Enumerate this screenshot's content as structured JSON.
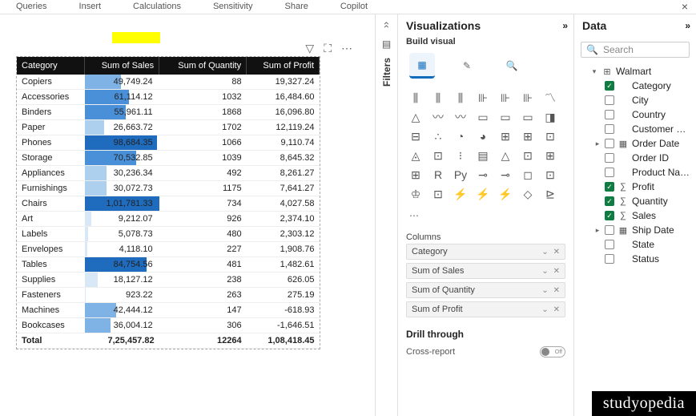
{
  "menu": {
    "queries": "Queries",
    "insert": "Insert",
    "calculations": "Calculations",
    "sensitivity": "Sensitivity",
    "share": "Share",
    "copilot": "Copilot",
    "close": "×"
  },
  "matrix": {
    "headers": {
      "category": "Category",
      "sales": "Sum of Sales",
      "quantity": "Sum of Quantity",
      "profit": "Sum of Profit"
    },
    "rows": [
      {
        "c": "Copiers",
        "s": "49,749.24",
        "sp": 49,
        "q": "88",
        "p": "19,327.24"
      },
      {
        "c": "Accessories",
        "s": "61,114.12",
        "sp": 60,
        "q": "1032",
        "p": "16,484.60"
      },
      {
        "c": "Binders",
        "s": "55,961.11",
        "sp": 55,
        "q": "1868",
        "p": "16,096.80"
      },
      {
        "c": "Paper",
        "s": "26,663.72",
        "sp": 26,
        "q": "1702",
        "p": "12,119.24"
      },
      {
        "c": "Phones",
        "s": "98,684.35",
        "sp": 97,
        "q": "1066",
        "p": "9,110.74"
      },
      {
        "c": "Storage",
        "s": "70,532.85",
        "sp": 69,
        "q": "1039",
        "p": "8,645.32"
      },
      {
        "c": "Appliances",
        "s": "30,236.34",
        "sp": 30,
        "q": "492",
        "p": "8,261.27"
      },
      {
        "c": "Furnishings",
        "s": "30,072.73",
        "sp": 30,
        "q": "1175",
        "p": "7,641.27"
      },
      {
        "c": "Chairs",
        "s": "1,01,781.33",
        "sp": 100,
        "q": "734",
        "p": "4,027.58"
      },
      {
        "c": "Art",
        "s": "9,212.07",
        "sp": 9,
        "q": "926",
        "p": "2,374.10"
      },
      {
        "c": "Labels",
        "s": "5,078.73",
        "sp": 5,
        "q": "480",
        "p": "2,303.12"
      },
      {
        "c": "Envelopes",
        "s": "4,118.10",
        "sp": 4,
        "q": "227",
        "p": "1,908.76"
      },
      {
        "c": "Tables",
        "s": "84,754.56",
        "sp": 83,
        "q": "481",
        "p": "1,482.61"
      },
      {
        "c": "Supplies",
        "s": "18,127.12",
        "sp": 18,
        "q": "238",
        "p": "626.05"
      },
      {
        "c": "Fasteners",
        "s": "923.22",
        "sp": 1,
        "q": "263",
        "p": "275.19"
      },
      {
        "c": "Machines",
        "s": "42,444.12",
        "sp": 42,
        "q": "147",
        "p": "-618.93"
      },
      {
        "c": "Bookcases",
        "s": "36,004.12",
        "sp": 35,
        "q": "306",
        "p": "-1,646.51"
      }
    ],
    "total": {
      "label": "Total",
      "s": "7,25,457.82",
      "q": "12264",
      "p": "1,08,418.45"
    }
  },
  "filters": {
    "label": "Filters"
  },
  "viz": {
    "title": "Visualizations",
    "subtitle": "Build visual",
    "more": "⋯",
    "columns_label": "Columns",
    "wells": [
      "Category",
      "Sum of Sales",
      "Sum of Quantity",
      "Sum of Profit"
    ],
    "drill": "Drill through",
    "crossreport": "Cross-report",
    "toggle_off": "Off"
  },
  "data": {
    "title": "Data",
    "search_placeholder": "Search",
    "table": "Walmart",
    "fields": [
      {
        "label": "Category",
        "checked": true
      },
      {
        "label": "City",
        "checked": false
      },
      {
        "label": "Country",
        "checked": false
      },
      {
        "label": "Customer Name",
        "checked": false
      },
      {
        "label": "Order Date",
        "checked": false,
        "icon": "date",
        "expandable": true
      },
      {
        "label": "Order ID",
        "checked": false
      },
      {
        "label": "Product Name",
        "checked": false
      },
      {
        "label": "Profit",
        "checked": true,
        "icon": "sigma"
      },
      {
        "label": "Quantity",
        "checked": true,
        "icon": "sigma"
      },
      {
        "label": "Sales",
        "checked": true,
        "icon": "sigma"
      },
      {
        "label": "Ship Date",
        "checked": false,
        "icon": "date",
        "expandable": true
      },
      {
        "label": "State",
        "checked": false
      },
      {
        "label": "Status",
        "checked": false
      }
    ]
  },
  "logo": "studyopedia"
}
